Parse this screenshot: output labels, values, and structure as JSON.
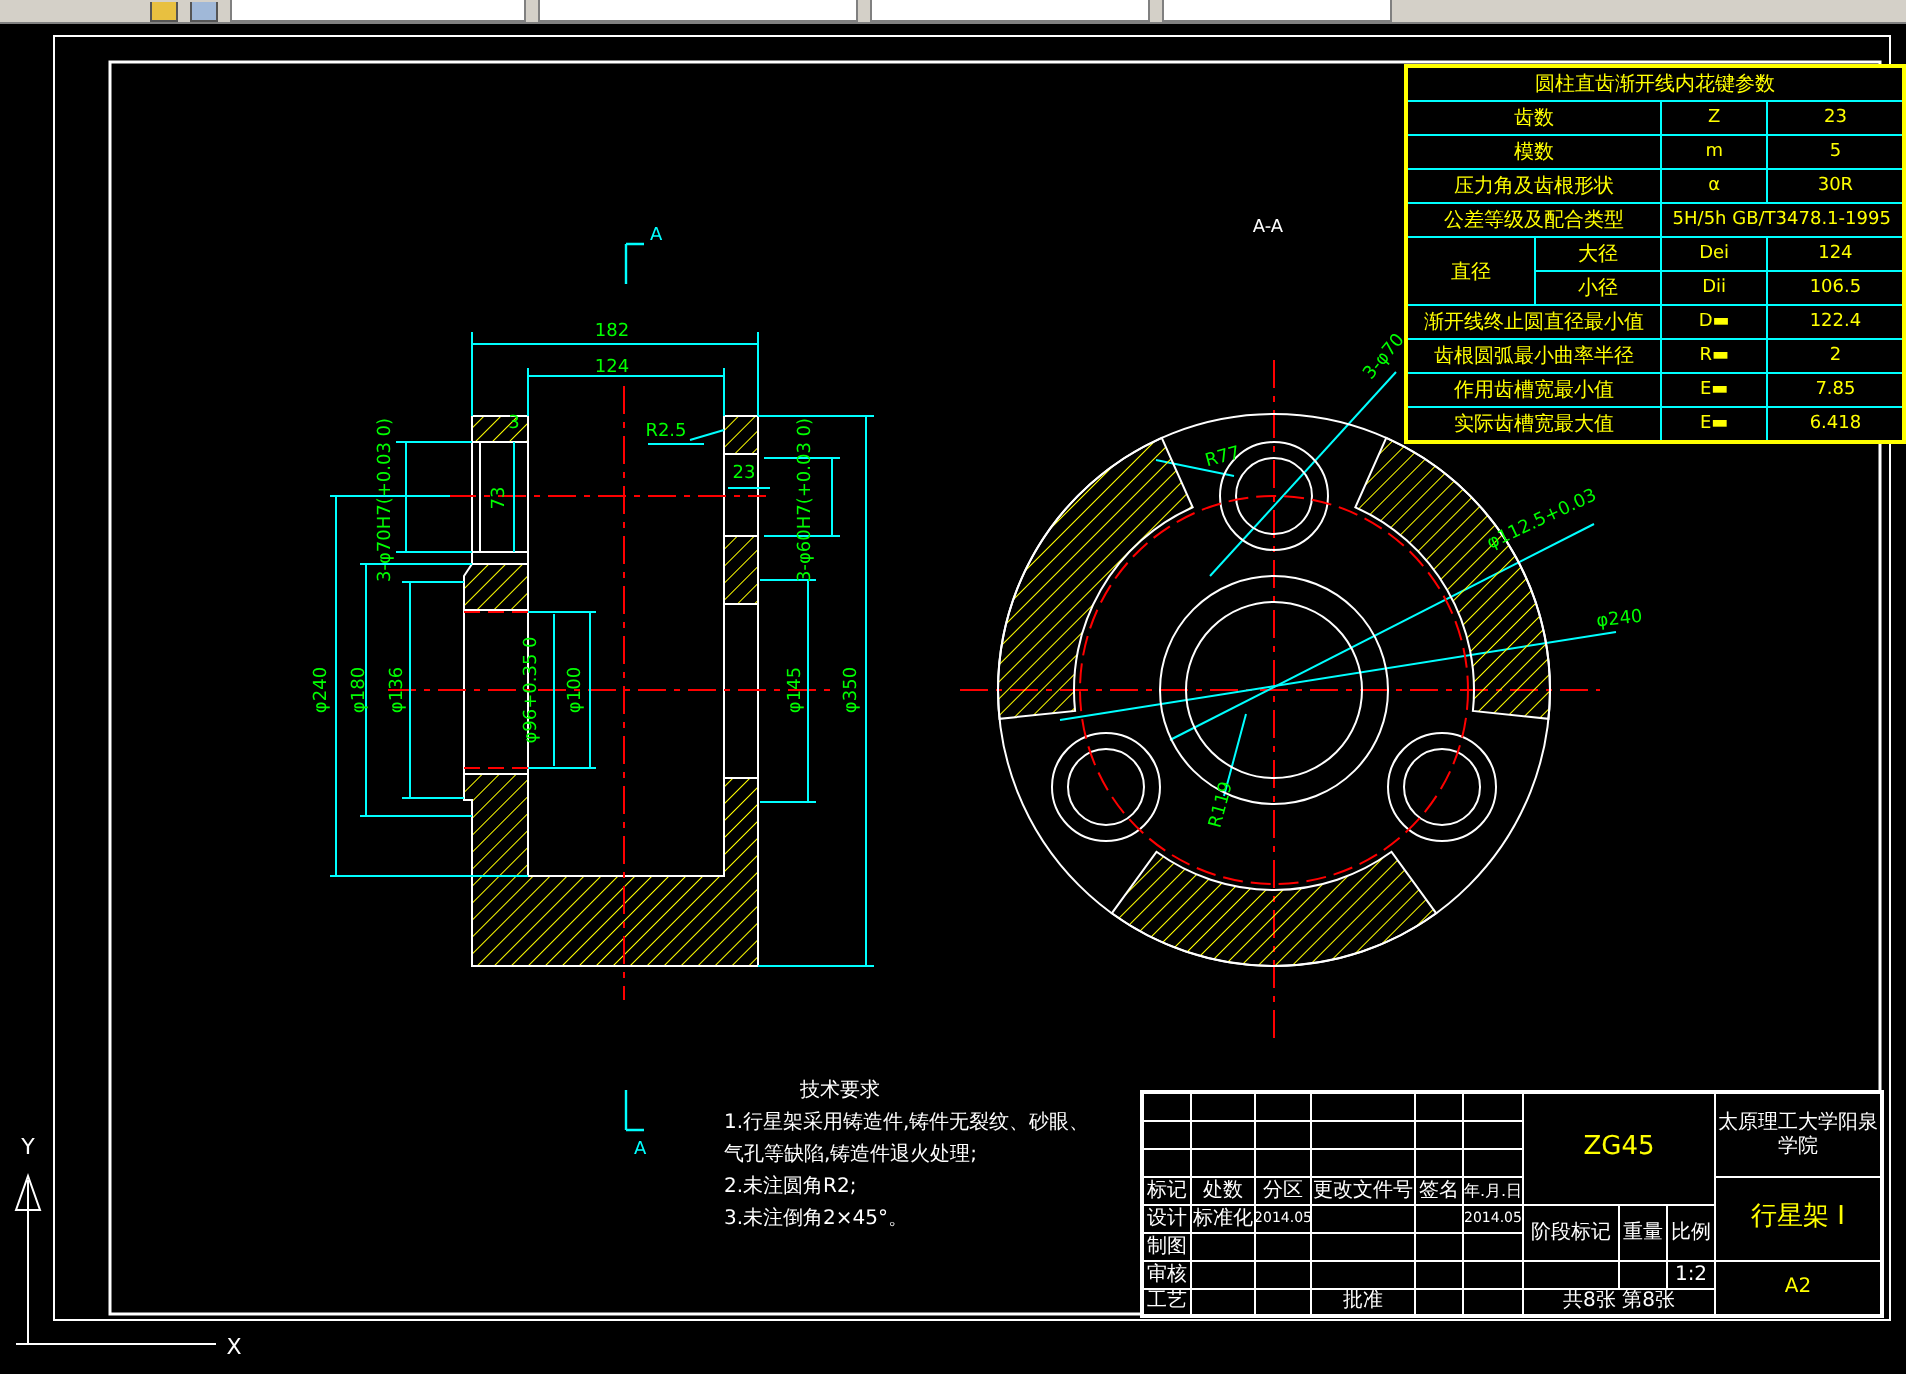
{
  "drawing": {
    "section_marks": [
      {
        "label": "A"
      },
      {
        "label": "A"
      }
    ],
    "section_title": "A-A",
    "front_dimensions": [
      {
        "text": "182"
      },
      {
        "text": "124"
      },
      {
        "text": "3"
      },
      {
        "text": "R2.5"
      },
      {
        "text": "23"
      },
      {
        "text": "73"
      },
      {
        "text": "3-φ70H7(+0.03 0)"
      },
      {
        "text": "3-φ60H7(+0.03 0)"
      },
      {
        "text": "φ240"
      },
      {
        "text": "φ180"
      },
      {
        "text": "φ136"
      },
      {
        "text": "φ96+0.35 0"
      },
      {
        "text": "φ100"
      },
      {
        "text": "φ145"
      },
      {
        "text": "φ350"
      }
    ],
    "side_dimensions": [
      {
        "text": "3-φ70"
      },
      {
        "text": "R77"
      },
      {
        "text": "φ112.5+0.03"
      },
      {
        "text": "φ240"
      },
      {
        "text": "R119"
      }
    ]
  },
  "parameter_table": {
    "title": "圆柱直齿渐开线内花键参数",
    "rows": [
      {
        "kind": "simple",
        "label": "齿数",
        "symbol": "Z",
        "value": "23"
      },
      {
        "kind": "simple",
        "label": "模数",
        "symbol": "m",
        "value": "5"
      },
      {
        "kind": "simple",
        "label": "压力角及齿根形状",
        "symbol": "α",
        "value": "30R"
      },
      {
        "kind": "span",
        "label": "公差等级及配合类型",
        "value": "5H/5h GB/T3478.1-1995"
      },
      {
        "kind": "group",
        "label": "直径",
        "subrows": [
          {
            "label": "大径",
            "symbol": "Dei",
            "value": "124"
          },
          {
            "label": "小径",
            "symbol": "Dii",
            "value": "106.5"
          }
        ]
      },
      {
        "kind": "simple",
        "label": "渐开线终止圆直径最小值",
        "symbol": "D▬",
        "value": "122.4"
      },
      {
        "kind": "simple",
        "label": "齿根圆弧最小曲率半径",
        "symbol": "R▬",
        "value": "2"
      },
      {
        "kind": "simple",
        "label": "作用齿槽宽最小值",
        "symbol": "E▬",
        "value": "7.85"
      },
      {
        "kind": "simple",
        "label": "实际齿槽宽最大值",
        "symbol": "E▬",
        "value": "6.418"
      }
    ]
  },
  "technical_requirements": {
    "title": "技术要求",
    "lines": [
      "1.行星架采用铸造件,铸件无裂纹、砂眼、",
      "气孔等缺陷,铸造件退火处理;",
      "2.未注圆角R2;",
      "3.未注倒角2×45°。"
    ]
  },
  "title_block": {
    "header": [
      "标记",
      "处数",
      "分区",
      "更改文件号",
      "签名",
      "年.月.日"
    ],
    "design_label": "设计",
    "standard_label": "标准化",
    "design_date": "2014.05",
    "sign_date": "2014.05",
    "draw_label": "制图",
    "review_label": "审核",
    "process_label": "工艺",
    "approve_label": "批准",
    "material": "ZG45",
    "stage_labels": [
      "阶段标记",
      "重量",
      "比例"
    ],
    "scale": "1:2",
    "sheets": "共8张 第8张",
    "school": "太原理工大学阳泉学院",
    "part_name": "行星架 I",
    "size": "A2"
  },
  "ucs": {
    "x_label": "X",
    "y_label": "Y"
  }
}
